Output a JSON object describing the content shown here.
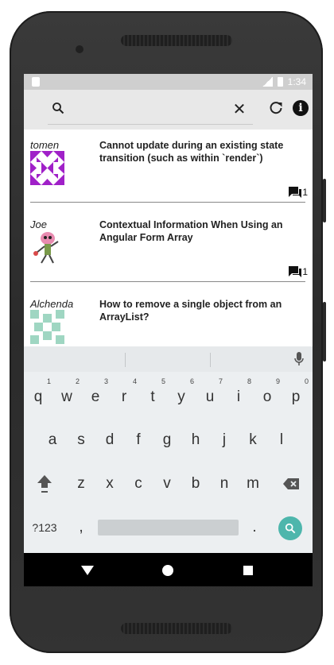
{
  "status": {
    "time": "1:34"
  },
  "search": {
    "placeholder": ""
  },
  "items": [
    {
      "author": "tomen",
      "title": "Cannot update during an existing state transition (such as within `render`)",
      "comments": "1"
    },
    {
      "author": "Joe",
      "title": "Contextual Information When Using an Angular Form Array",
      "comments": "1"
    },
    {
      "author": "Alchenda",
      "title": "How to remove a single object from an ArrayList?",
      "comments": ""
    }
  ],
  "keyboard": {
    "row1": [
      "q",
      "w",
      "e",
      "r",
      "t",
      "y",
      "u",
      "i",
      "o",
      "p"
    ],
    "row1_hints": [
      "1",
      "2",
      "3",
      "4",
      "5",
      "6",
      "7",
      "8",
      "9",
      "0"
    ],
    "row2": [
      "a",
      "s",
      "d",
      "f",
      "g",
      "h",
      "j",
      "k",
      "l"
    ],
    "row3": [
      "z",
      "x",
      "c",
      "v",
      "b",
      "n",
      "m"
    ],
    "symbols_label": "?123",
    "comma": ",",
    "period": "."
  },
  "colors": {
    "accent": "#4db6ac",
    "appbar": "#e8e8e8",
    "statusbar": "#cfcfcf"
  }
}
